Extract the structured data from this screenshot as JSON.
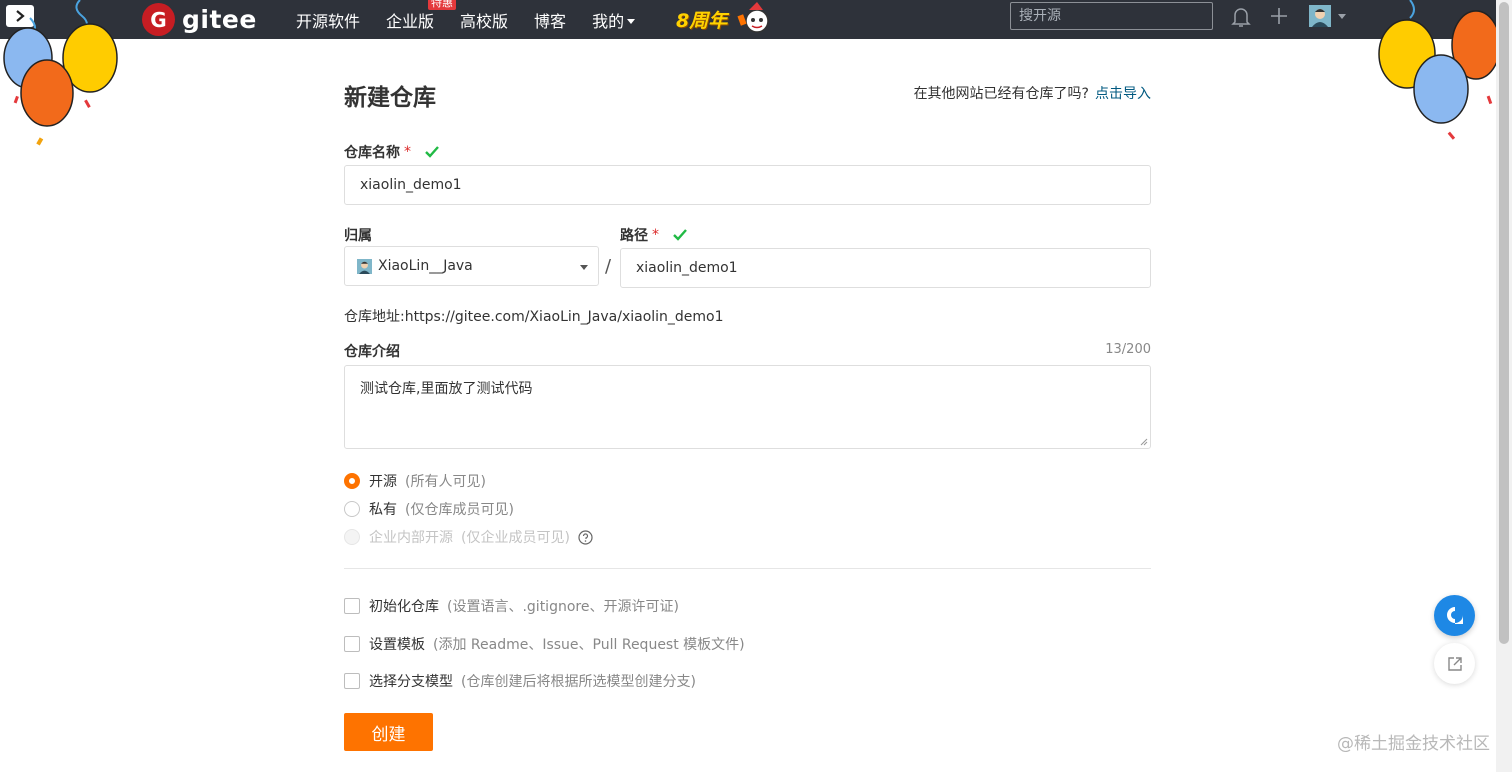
{
  "nav": {
    "brand": "gitee",
    "items": [
      {
        "label": "开源软件"
      },
      {
        "label": "企业版",
        "badge": "特惠"
      },
      {
        "label": "高校版"
      },
      {
        "label": "博客"
      },
      {
        "label": "我的"
      }
    ],
    "anniversary": "8周年",
    "search_placeholder": "搜开源"
  },
  "page": {
    "title": "新建仓库",
    "import_hint": "在其他网站已经有仓库了吗?",
    "import_link": "点击导入"
  },
  "form": {
    "name_label": "仓库名称",
    "required_mark": "*",
    "name_value": "xiaolin_demo1",
    "owner_label": "归属",
    "owner_value": "XiaoLin__Java",
    "path_label": "路径",
    "path_separator": "/",
    "path_value": "xiaolin_demo1",
    "url_prefix": "仓库地址:",
    "url_value": "https://gitee.com/XiaoLin_Java/xiaolin_demo1",
    "desc_label": "仓库介绍",
    "desc_counter": "13/200",
    "desc_value": "测试仓库,里面放了测试代码",
    "visibility": [
      {
        "label": "开源",
        "hint": "(所有人可见)",
        "selected": true,
        "disabled": false
      },
      {
        "label": "私有",
        "hint": "(仅仓库成员可见)",
        "selected": false,
        "disabled": false
      },
      {
        "label": "企业内部开源",
        "hint": "(仅企业成员可见)",
        "selected": false,
        "disabled": true
      }
    ],
    "options": [
      {
        "label": "初始化仓库",
        "hint": "(设置语言、.gitignore、开源许可证)",
        "checked": false
      },
      {
        "label": "设置模板",
        "hint": "(添加 Readme、Issue、Pull Request 模板文件)",
        "checked": false
      },
      {
        "label": "选择分支模型",
        "hint": "(仓库创建后将根据所选模型创建分支)",
        "checked": false
      }
    ],
    "submit_label": "创建"
  },
  "watermark": "@稀土掘金技术社区",
  "colors": {
    "topbar": "#2e323a",
    "brand_red": "#c71d23",
    "accent_orange": "#fe7300",
    "link_blue": "#005980",
    "check_green": "#21ba45"
  }
}
